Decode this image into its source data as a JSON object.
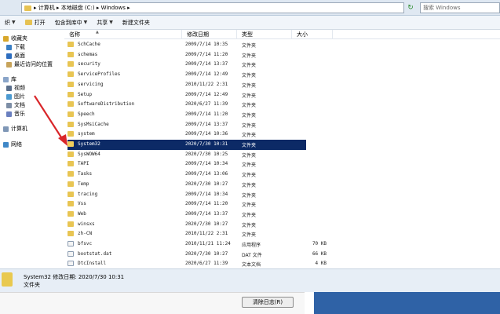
{
  "address_bar": {
    "path": "▸ 计算机 ▸ 本地磁盘 (C:) ▸ Windows ▸",
    "search_placeholder": "搜索 Windows"
  },
  "toolbar": {
    "organize_fragment": "织",
    "open_label": "打开",
    "include_label": "包含到库中",
    "share_label": "共享",
    "new_folder_label": "新建文件夹"
  },
  "nav": {
    "favorites": "收藏夹",
    "downloads": "下载",
    "desktop": "桌面",
    "recent": "最近访问的位置",
    "libraries": "库",
    "videos": "视频",
    "pictures": "图片",
    "documents": "文档",
    "music": "音乐",
    "computer": "计算机",
    "network": "网络"
  },
  "columns": {
    "name": "名称",
    "date": "修改日期",
    "type": "类型",
    "size": "大小"
  },
  "files": [
    {
      "name": "SchCache",
      "date": "2009/7/14 10:35",
      "type": "文件夹",
      "size": ""
    },
    {
      "name": "schemas",
      "date": "2009/7/14 11:20",
      "type": "文件夹",
      "size": ""
    },
    {
      "name": "security",
      "date": "2009/7/14 13:37",
      "type": "文件夹",
      "size": ""
    },
    {
      "name": "ServiceProfiles",
      "date": "2009/7/14 12:49",
      "type": "文件夹",
      "size": ""
    },
    {
      "name": "servicing",
      "date": "2010/11/22 2:31",
      "type": "文件夹",
      "size": ""
    },
    {
      "name": "Setup",
      "date": "2009/7/14 12:49",
      "type": "文件夹",
      "size": ""
    },
    {
      "name": "SoftwareDistribution",
      "date": "2020/6/27 11:39",
      "type": "文件夹",
      "size": ""
    },
    {
      "name": "Speech",
      "date": "2009/7/14 11:20",
      "type": "文件夹",
      "size": ""
    },
    {
      "name": "SysMsiCache",
      "date": "2009/7/14 13:37",
      "type": "文件夹",
      "size": ""
    },
    {
      "name": "system",
      "date": "2009/7/14 10:36",
      "type": "文件夹",
      "size": ""
    },
    {
      "name": "System32",
      "date": "2020/7/30 10:31",
      "type": "文件夹",
      "size": ""
    },
    {
      "name": "SysWOW64",
      "date": "2020/7/30 10:25",
      "type": "文件夹",
      "size": ""
    },
    {
      "name": "TAPI",
      "date": "2009/7/14 10:34",
      "type": "文件夹",
      "size": ""
    },
    {
      "name": "Tasks",
      "date": "2009/7/14 13:06",
      "type": "文件夹",
      "size": ""
    },
    {
      "name": "Temp",
      "date": "2020/7/30 10:27",
      "type": "文件夹",
      "size": ""
    },
    {
      "name": "tracing",
      "date": "2009/7/14 10:34",
      "type": "文件夹",
      "size": ""
    },
    {
      "name": "Vss",
      "date": "2009/7/14 11:20",
      "type": "文件夹",
      "size": ""
    },
    {
      "name": "Web",
      "date": "2009/7/14 13:37",
      "type": "文件夹",
      "size": ""
    },
    {
      "name": "winsxs",
      "date": "2020/7/30 10:27",
      "type": "文件夹",
      "size": ""
    },
    {
      "name": "zh-CN",
      "date": "2010/11/22 2:31",
      "type": "文件夹",
      "size": ""
    },
    {
      "name": "bfsvc",
      "date": "2010/11/21 11:24",
      "type": "应用程序",
      "size": "70 KB"
    },
    {
      "name": "bootstat.dat",
      "date": "2020/7/30 10:27",
      "type": "DAT 文件",
      "size": "66 KB"
    },
    {
      "name": "DtcInstall",
      "date": "2020/6/27 11:39",
      "type": "文本文档",
      "size": "4 KB"
    }
  ],
  "selected_index": 10,
  "details": {
    "name": "System32",
    "date_label": "修改日期:",
    "date": "2020/7/30 10:31",
    "type": "文件夹"
  },
  "bottom": {
    "clear_log": "清除日志(R)"
  }
}
